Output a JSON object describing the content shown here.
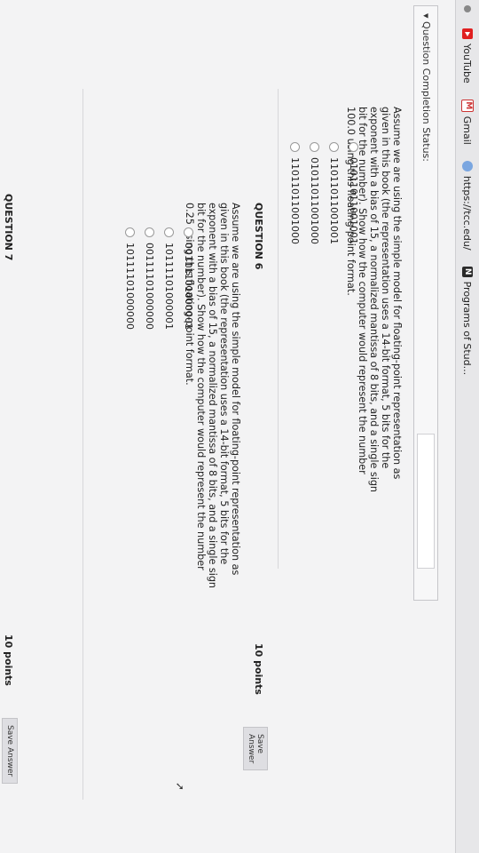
{
  "bookmarks": [
    {
      "label": "YouTube"
    },
    {
      "label": "Gmail"
    },
    {
      "label": "https://tcc.edu/"
    },
    {
      "label": "Programs of Stud..."
    }
  ],
  "status": {
    "label": "Question Completion Status:"
  },
  "question5": {
    "text": "Assume we are using the simple model for floating-point representation as given in this book (the representation uses a 14-bit format, 5 bits for the exponent with a bias of 15, a normalized mantissa of 8 bits, and a single sign bit for the number). Show how the computer would represent the number 100.0 using this floating-point format.",
    "options": [
      "01011011001001",
      "11011011001001",
      "01011011001000",
      "11011011001000"
    ]
  },
  "question6": {
    "title": "QUESTION 6",
    "points": "10 points",
    "save_label": "Save Answer",
    "text": "Assume we are using the simple model for floating-point representation as given in this book (the representation uses a 14-bit format, 5 bits for the exponent with a bias of 15, a normalized mantissa of 8 bits, and a single sign bit for the number). Show how the computer would represent the number 0.25 using this floating-point format.",
    "options": [
      "00111101000001",
      "10111101000001",
      "00111101000000",
      "10111101000000"
    ]
  },
  "question7": {
    "title": "QUESTION 7",
    "points": "10 points",
    "save_label": "Save Answer"
  }
}
